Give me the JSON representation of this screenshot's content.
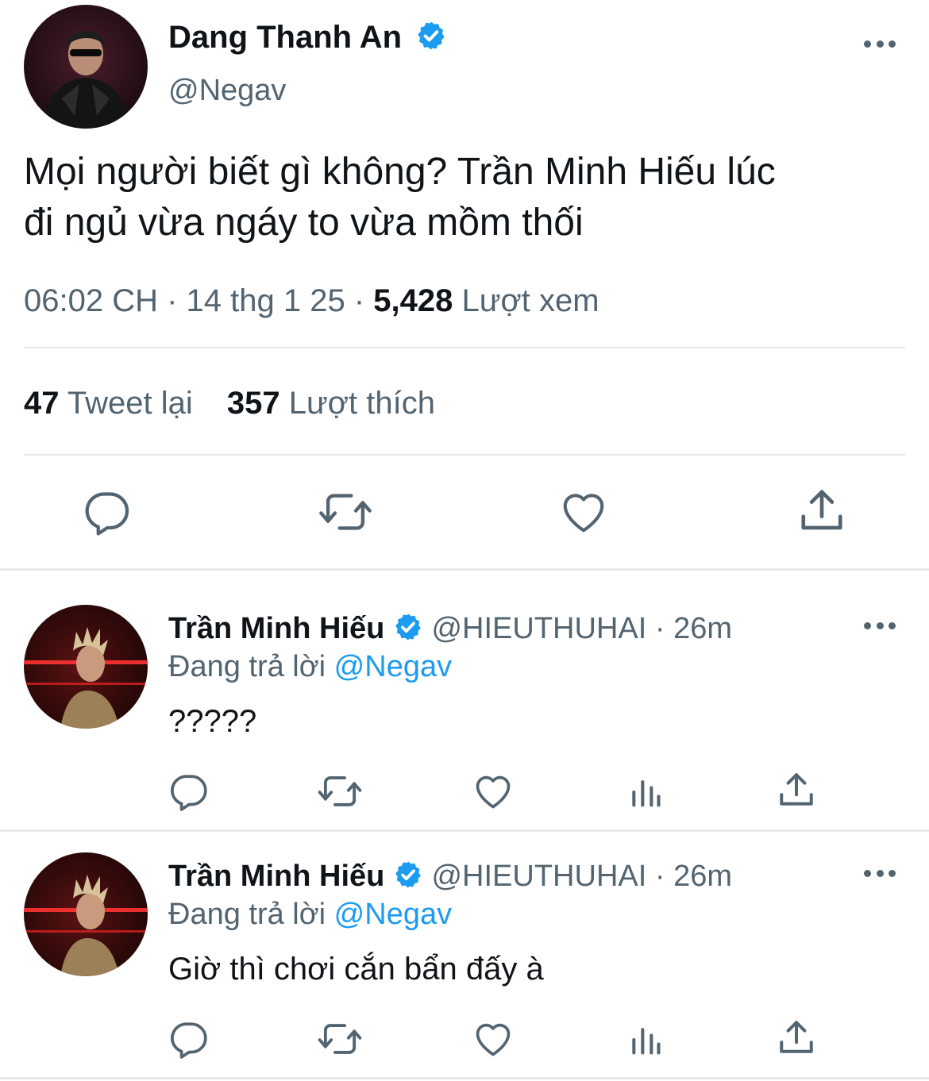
{
  "main_tweet": {
    "author_name": "Dang Thanh An",
    "handle": "@Negav",
    "text_line1": "Mọi người biết gì không? Trần Minh Hiếu lúc",
    "text_line2": "đi ngủ vừa ngáy to vừa mồm thối",
    "time": "06:02 CH",
    "sep1": " · ",
    "date": "14 thg 1 25",
    "sep2": " · ",
    "views_count": "5,428",
    "views_label": "Lượt xem",
    "retweets_count": "47",
    "retweets_label": "Tweet lại",
    "likes_count": "357",
    "likes_label": "Lượt thích"
  },
  "replies": [
    {
      "author_name": "Trần Minh Hiếu",
      "handle": "@HIEUTHUHAI",
      "sep": " · ",
      "time": "26m",
      "replying_prefix": "Đang trả lời",
      "replying_to": "@Negav",
      "text": "?????"
    },
    {
      "author_name": "Trần Minh Hiếu",
      "handle": "@HIEUTHUHAI",
      "sep": " · ",
      "time": "26m",
      "replying_prefix": "Đang trả lời",
      "replying_to": "@Negav",
      "text": "Giờ thì chơi cắn bẩn đấy à"
    }
  ],
  "colors": {
    "accent": "#1d9bf0",
    "text": "#0f1419",
    "muted": "#536471",
    "divider": "#e6e9ea"
  },
  "icons": [
    "verified-badge-icon",
    "more-icon",
    "reply-icon",
    "retweet-icon",
    "like-icon",
    "share-icon",
    "analytics-icon"
  ]
}
